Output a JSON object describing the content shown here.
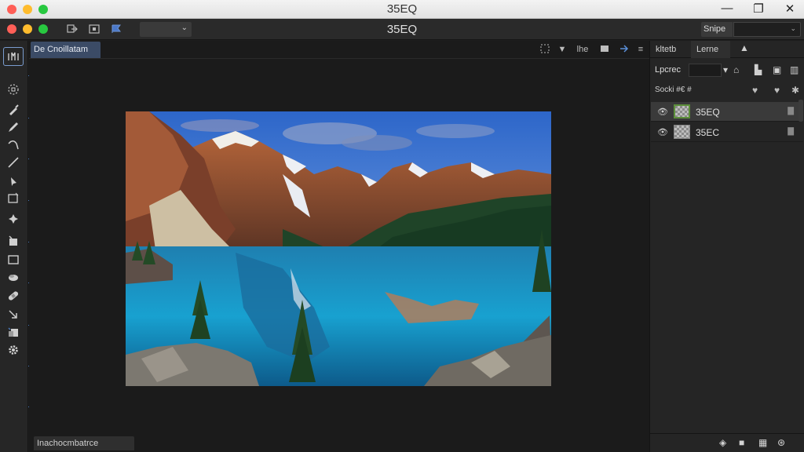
{
  "window": {
    "os_title": "35EQ",
    "app_title": "35EQ"
  },
  "os_controls": {
    "minimize": "—",
    "maximize": "❐",
    "close": "✕"
  },
  "app_toolbar": {
    "tool_icons": [
      "export-icon",
      "frame-icon",
      "flag-icon"
    ],
    "search_label": "Snipe"
  },
  "document": {
    "tab_label": "De Cnoillatam",
    "bottom_tab_label": "Inachocmbatrce"
  },
  "canvas_tools": {
    "view_label": "lhe"
  },
  "left_tools": [
    "home-icon",
    "lasso-icon",
    "brush-icon",
    "pencil-icon",
    "curve-icon",
    "line-icon",
    "pen-icon",
    "crop-icon",
    "heal-icon",
    "mask-icon",
    "square-icon",
    "blob-icon",
    "bandage-icon",
    "move-icon",
    "layers-icon",
    "gear-icon"
  ],
  "right_panel": {
    "tabs": [
      "kltetb",
      "Lerne"
    ],
    "blend_label": "Lpcrec",
    "lock_label": "Socki #€ #",
    "layers": [
      {
        "name": "35EQ",
        "selected": true
      },
      {
        "name": "35EC",
        "selected": false
      }
    ]
  },
  "colors": {
    "accent": "#4a78b8",
    "tab_active": "#3b4b66",
    "traffic_red": "#ff5f57",
    "traffic_yellow": "#febc2e",
    "traffic_green": "#28c840"
  }
}
